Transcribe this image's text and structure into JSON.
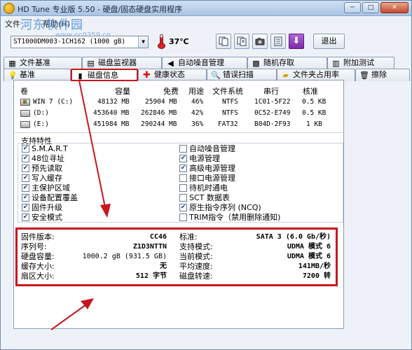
{
  "window": {
    "title": "HD Tune 专业版 5.50 - 硬盘/固态硬盘实用程序",
    "title_icon": "hdtune-app-icon"
  },
  "watermark": {
    "text": "河东软件园",
    "url": "www.pc0359.cn"
  },
  "menu": {
    "file": "文件",
    "help": "帮助(H)"
  },
  "toolbar": {
    "drive_value": "ST1000DM003-1CH162 (1000 gB)",
    "temperature": "37℃",
    "exit_label": "退出"
  },
  "tabs_row1": [
    {
      "label": "文件基准",
      "icon": "file-benchmark-icon"
    },
    {
      "label": "磁盘监视器",
      "icon": "disk-monitor-icon"
    },
    {
      "label": "自动噪音管理",
      "icon": "speaker-icon"
    },
    {
      "label": "随机存取",
      "icon": "random-access-icon"
    },
    {
      "label": "附加测试",
      "icon": "extra-tests-icon"
    }
  ],
  "tabs_row2": [
    {
      "label": "基准",
      "icon": "benchmark-icon"
    },
    {
      "label": "磁盘信息",
      "icon": "disk-info-icon",
      "active": true
    },
    {
      "label": "健康状态",
      "icon": "health-cross-icon"
    },
    {
      "label": "错误扫描",
      "icon": "magnifier-icon"
    },
    {
      "label": "文件夹占用率",
      "icon": "folder-icon"
    },
    {
      "label": "擦除",
      "icon": "trash-icon"
    }
  ],
  "volumes": {
    "headers": [
      "卷",
      "容量",
      "免费",
      "用途",
      "文件系统",
      "串行",
      "核准"
    ],
    "rows": [
      {
        "name": "WIN 7 (C:)",
        "capacity": "48132 MB",
        "free": "25904 MB",
        "usage": "46%",
        "fs": "NTFS",
        "serial": "1C01-5F22",
        "cluster": "0.5 KB"
      },
      {
        "name": "(D:)",
        "capacity": "453640 MB",
        "free": "262846 MB",
        "usage": "42%",
        "fs": "NTFS",
        "serial": "0C52-E749",
        "cluster": "0.5 KB"
      },
      {
        "name": "(E:)",
        "capacity": "451984 MB",
        "free": "290244 MB",
        "usage": "36%",
        "fs": "FAT32",
        "serial": "B04D-2F93",
        "cluster": "1 KB"
      }
    ]
  },
  "features": {
    "title": "支持特性",
    "left": [
      {
        "label": "S.M.A.R.T",
        "checked": true
      },
      {
        "label": "48位寻址",
        "checked": true
      },
      {
        "label": "预先读取",
        "checked": true
      },
      {
        "label": "写入缓存",
        "checked": true
      },
      {
        "label": "主保护区域",
        "checked": true
      },
      {
        "label": "设备配置覆盖",
        "checked": true
      },
      {
        "label": "固件升级",
        "checked": true
      },
      {
        "label": "安全模式",
        "checked": true
      }
    ],
    "right": [
      {
        "label": "自动噪音管理",
        "checked": false
      },
      {
        "label": "电源管理",
        "checked": true
      },
      {
        "label": "高级电源管理",
        "checked": true
      },
      {
        "label": "接口电源管理",
        "checked": false
      },
      {
        "label": "待机时通电",
        "checked": false
      },
      {
        "label": "SCT 数据表",
        "checked": false
      },
      {
        "label": "原生指令序列 (NCQ)",
        "checked": true
      },
      {
        "label": "TRIM指令（禁用删除通知)",
        "checked": false
      }
    ]
  },
  "info": {
    "left": [
      {
        "label": "固件版本:",
        "value": "CC46"
      },
      {
        "label": "序列号:",
        "value": "Z1D3NTTN"
      },
      {
        "label": "硬盘容量:",
        "value": "1000.2 gB (931.5 GB)"
      },
      {
        "label": "缓存大小:",
        "value": "无"
      },
      {
        "label": "扇区大小:",
        "value": "512 字节"
      }
    ],
    "right": [
      {
        "label": "标准:",
        "value": "SATA 3 (6.0 Gb/秒)"
      },
      {
        "label": "支持模式:",
        "value": "UDMA 模式 6"
      },
      {
        "label": "当前模式:",
        "value": "UDMA 模式 6"
      },
      {
        "label": "平均速度:",
        "value": "141MB/秒"
      },
      {
        "label": "磁盘转速:",
        "value": "7200 转"
      }
    ]
  },
  "annotation_color": "#c8161e"
}
